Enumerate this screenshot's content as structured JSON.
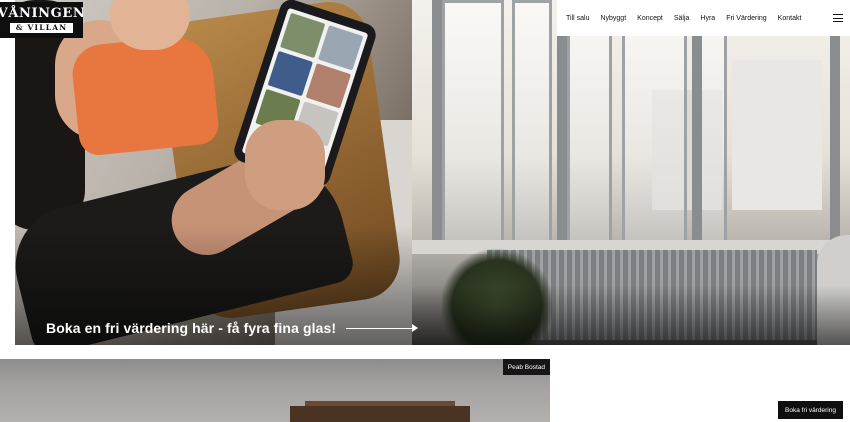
{
  "brand": {
    "logo_top": "VÅNINGEN",
    "logo_bottom": "& VILLAN"
  },
  "nav": {
    "items": [
      {
        "label": "Till salu"
      },
      {
        "label": "Nybyggt"
      },
      {
        "label": "Koncept"
      },
      {
        "label": "Sälja"
      },
      {
        "label": "Hyra"
      },
      {
        "label": "Fri Värdering"
      },
      {
        "label": "Kontakt"
      }
    ],
    "menu_icon": "hamburger-menu-icon"
  },
  "hero": {
    "cta_text": "Boka en fri värdering här - få fyra fina glas!",
    "cta_icon": "arrow-right-icon"
  },
  "listing": {
    "tag": "Peab Bostad"
  },
  "floating": {
    "book_label": "Boka fri värdering"
  },
  "colors": {
    "brand_black": "#0f0f0f",
    "text_white": "#ffffff"
  }
}
